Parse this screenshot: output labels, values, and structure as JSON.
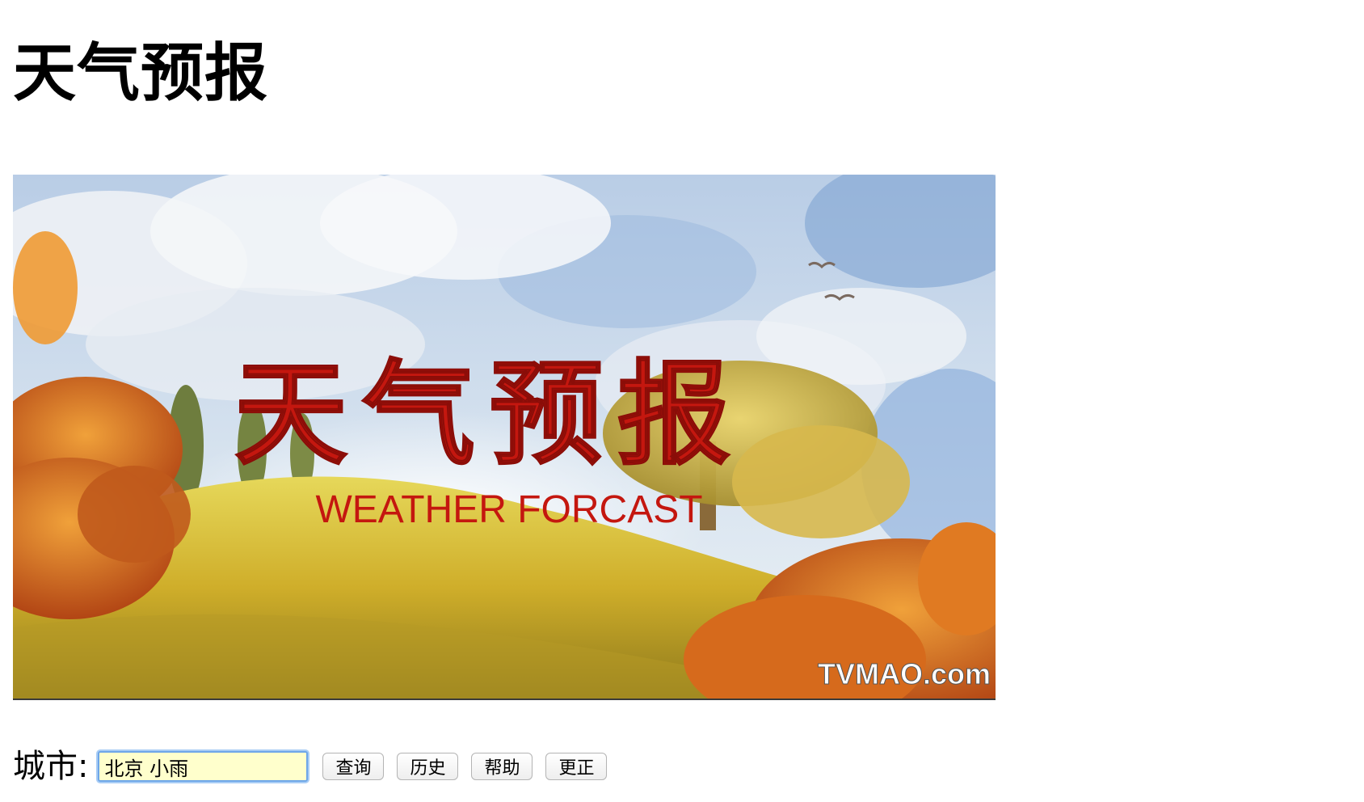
{
  "page": {
    "title": "天气预报"
  },
  "banner": {
    "title_cn": "天气预报",
    "title_en": "WEATHER FORCAST",
    "watermark": "TVMAO.com",
    "colors": {
      "sky": "#a8c6e6",
      "cloud": "#f2f4f7",
      "grass": "#d9c23a",
      "foliage": "#d56a1f",
      "title_red": "#c4170f"
    }
  },
  "form": {
    "city_label": "城市:",
    "city_value": "北京 小雨",
    "buttons": {
      "query": "查询",
      "history": "历史",
      "help": "帮助",
      "correct": "更正"
    }
  }
}
